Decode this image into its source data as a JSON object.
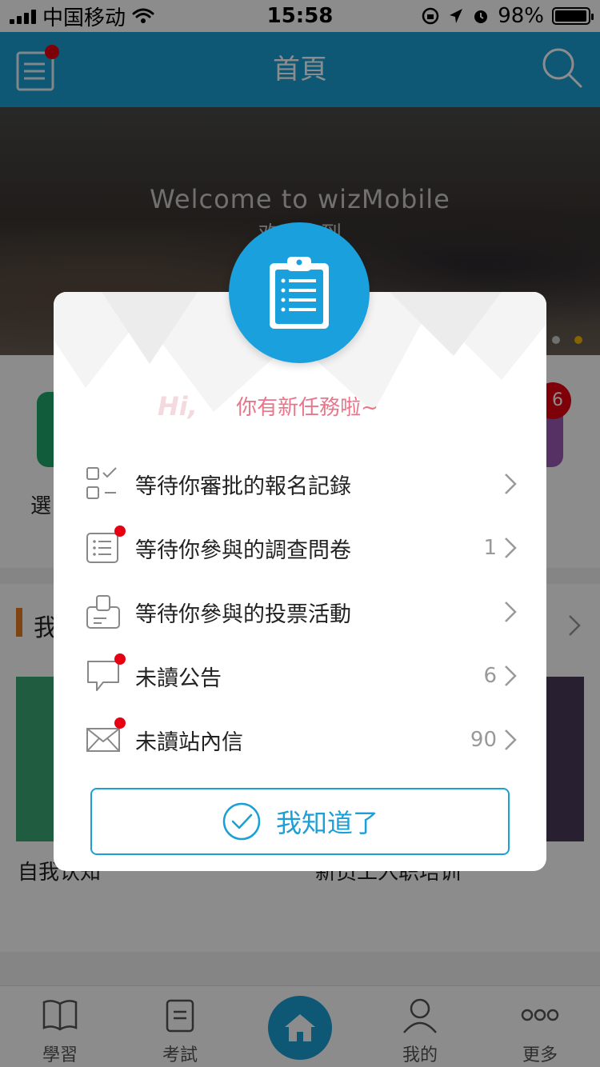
{
  "status_bar": {
    "carrier": "中国移动",
    "time": "15:58",
    "battery": "98%",
    "battery_level": 0.98
  },
  "header": {
    "title": "首頁"
  },
  "banner": {
    "title": "Welcome to wizMobile",
    "subtitle": "欢迎来到",
    "active_dot": 1
  },
  "background": {
    "quick_label": "選",
    "quick_badge": "6",
    "section_title": "我",
    "course_1": "自我认知",
    "course_2": "新员工入职培训"
  },
  "modal": {
    "greeting": "Hi,",
    "subtitle": "你有新任務啦~",
    "tasks": [
      {
        "label": "等待你審批的報名記錄",
        "count": "",
        "icon": "approval-icon",
        "unread": false
      },
      {
        "label": "等待你參與的調查問卷",
        "count": "1",
        "icon": "survey-icon",
        "unread": true
      },
      {
        "label": "等待你參與的投票活動",
        "count": "",
        "icon": "vote-icon",
        "unread": false
      },
      {
        "label": "未讀公告",
        "count": "6",
        "icon": "announcement-icon",
        "unread": true
      },
      {
        "label": "未讀站內信",
        "count": "90",
        "icon": "mail-icon",
        "unread": true
      }
    ],
    "confirm_label": "我知道了"
  },
  "tabbar": {
    "items": [
      {
        "label": "學習",
        "icon": "book-icon"
      },
      {
        "label": "考試",
        "icon": "exam-icon"
      },
      {
        "label": "",
        "icon": "home-icon"
      },
      {
        "label": "我的",
        "icon": "user-icon"
      },
      {
        "label": "更多",
        "icon": "more-icon"
      }
    ]
  },
  "colors": {
    "brand": "#1a9fd6",
    "alert": "#e60012",
    "subtitle_pink": "#e8768a"
  }
}
